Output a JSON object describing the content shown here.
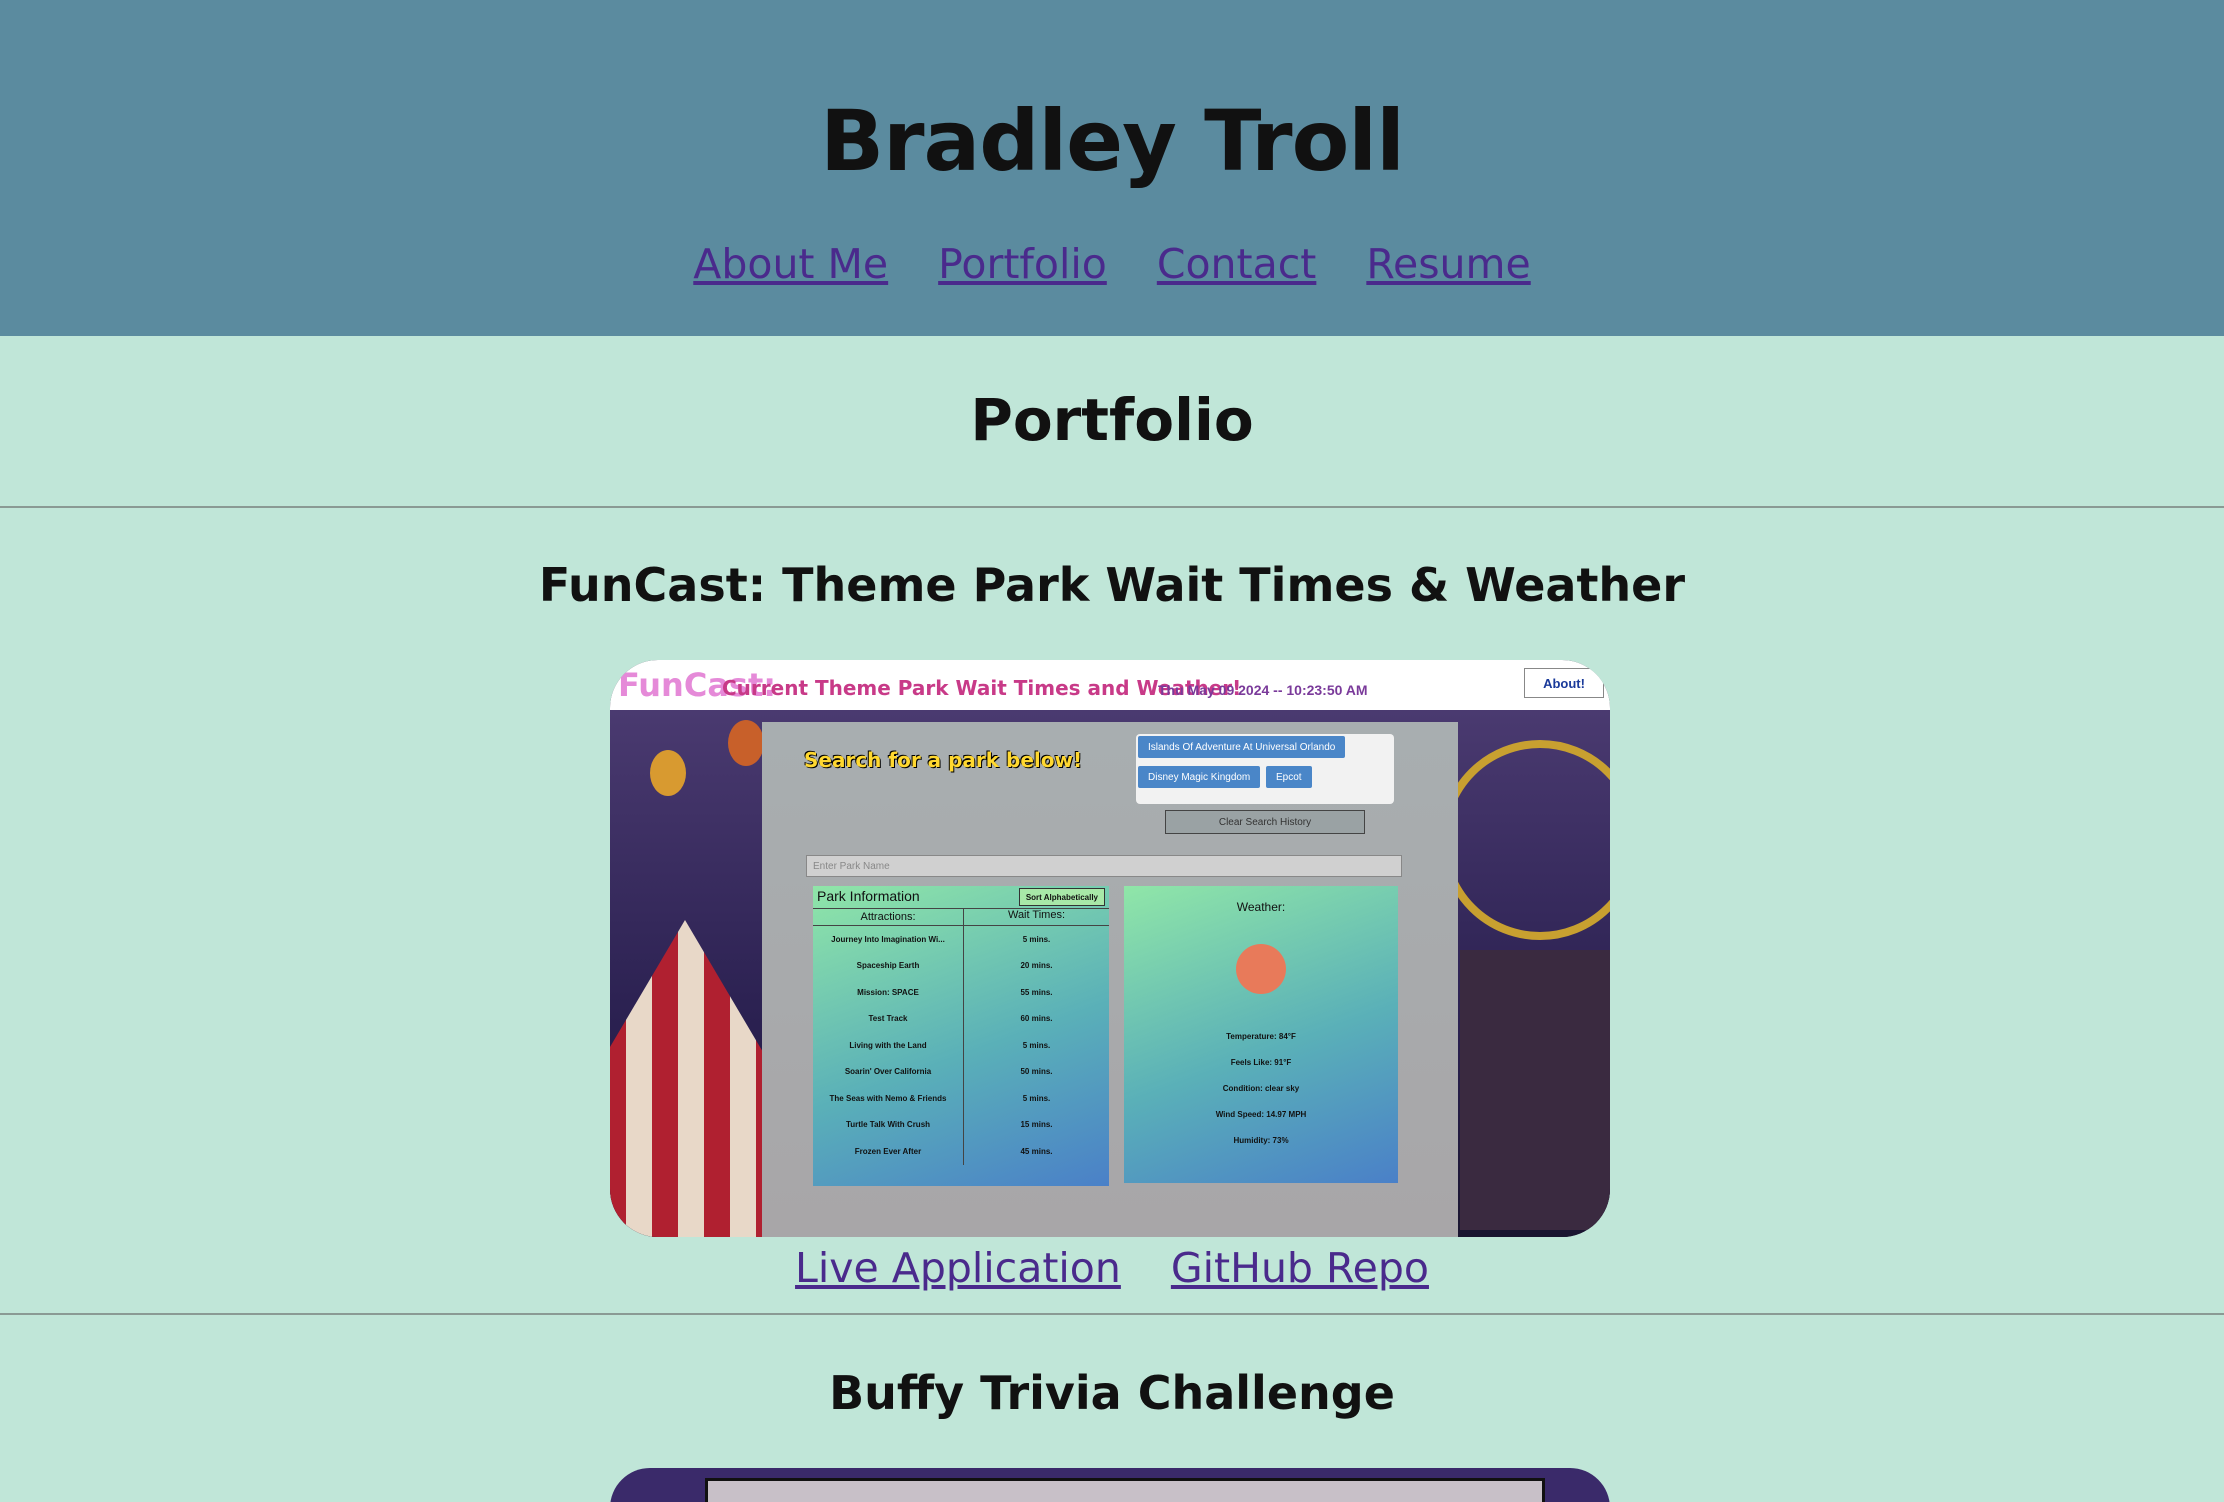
{
  "header": {
    "name": "Bradley Troll",
    "nav": [
      "About Me",
      "Portfolio",
      "Contact",
      "Resume"
    ]
  },
  "portfolio": {
    "title": "Portfolio",
    "projects": [
      {
        "title": "FunCast: Theme Park Wait Times & Weather",
        "links": [
          "Live Application",
          "GitHub Repo"
        ],
        "screenshot": {
          "logo": "FunCast:",
          "tagline": "Current Theme Park Wait Times and Weather!",
          "datetime": "Thu May 09 2024 -- 10:23:50 AM",
          "about_button": "About!",
          "search_heading": "Search for a park below!",
          "history": [
            "Islands Of Adventure At Universal Orlando",
            "Disney Magic Kingdom",
            "Epcot"
          ],
          "clear_button": "Clear Search History",
          "input_placeholder": "Enter Park Name",
          "info_title": "Park Information",
          "sort_button": "Sort Alphabetically",
          "col_attractions": "Attractions:",
          "col_wait": "Wait Times:",
          "rows": [
            {
              "name": "Journey Into Imagination Wi...",
              "wait": "5 mins."
            },
            {
              "name": "Spaceship Earth",
              "wait": "20 mins."
            },
            {
              "name": "Mission: SPACE",
              "wait": "55 mins."
            },
            {
              "name": "Test Track",
              "wait": "60 mins."
            },
            {
              "name": "Living with the Land",
              "wait": "5 mins."
            },
            {
              "name": "Soarin' Over California",
              "wait": "50 mins."
            },
            {
              "name": "The Seas with Nemo & Friends",
              "wait": "5 mins."
            },
            {
              "name": "Turtle Talk With Crush",
              "wait": "15 mins."
            },
            {
              "name": "Frozen Ever After",
              "wait": "45 mins."
            }
          ],
          "weather_label": "Weather:",
          "weather": [
            "Temperature: 84°F",
            "Feels Like: 91°F",
            "Condition: clear sky",
            "Wind Speed: 14.97 MPH",
            "Humidity: 73%"
          ]
        }
      },
      {
        "title": "Buffy Trivia Challenge"
      }
    ]
  }
}
